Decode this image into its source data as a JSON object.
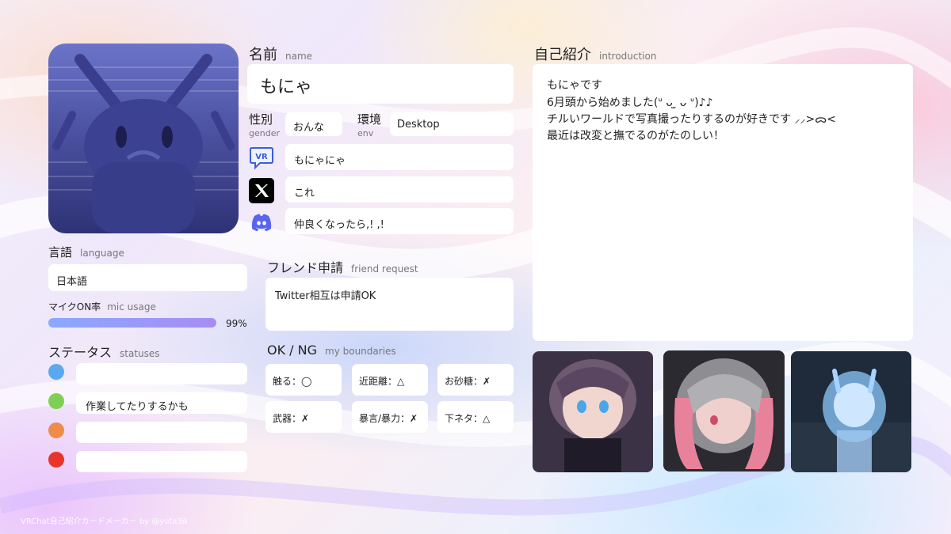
{
  "profile": {
    "name_label": "名前",
    "name_label_en": "name",
    "name_value": "もにゃ",
    "gender_label": "性別",
    "gender_label_en": "gender",
    "gender_value": "おんな",
    "env_label": "環境",
    "env_label_en": "env",
    "env_value": "Desktop",
    "vrchat_id": "もにゃにゃ",
    "x_id": "これ",
    "discord_id": "仲良くなったら,! ,!"
  },
  "language": {
    "label": "言語",
    "label_en": "language",
    "value": "日本語"
  },
  "mic": {
    "label": "マイクON率",
    "label_en": "mic usage",
    "percent_text": "99%",
    "level": 0.99
  },
  "statuses": {
    "label": "ステータス",
    "label_en": "statuses",
    "items": [
      {
        "color": "#5ba8ef",
        "text": ""
      },
      {
        "color": "#7fcf56",
        "text": "作業してたりするかも"
      },
      {
        "color": "#ef8c4a",
        "text": ""
      },
      {
        "color": "#e8352c",
        "text": ""
      }
    ]
  },
  "friend_request": {
    "label": "フレンド申請",
    "label_en": "friend request",
    "value": "Twitter相互は申請OK"
  },
  "boundaries": {
    "label": "OK / NG",
    "label_en": "my boundaries",
    "items": [
      "触る：◯",
      "近距離：△",
      "お砂糖：✗",
      "武器：✗",
      "暴言/暴力：✗",
      "下ネタ：△"
    ]
  },
  "introduction": {
    "label": "自己紹介",
    "label_en": "introduction",
    "lines": [
      "もにゃです",
      "6月頭から始めました(ᐡ ᴗ ̫ ᴗ ᐡ)♪♪",
      "チルいワールドで写真撮ったりするのが好きです ⸝⸝>ᯅ<",
      "最近は改変と撫でるのがたのしい！"
    ]
  },
  "footer": "VRChat自己紹介カードメーカー by @yota3d",
  "icons": {
    "vrchat": "vrchat-icon",
    "x": "x-logo-icon",
    "discord": "discord-icon"
  },
  "colors": {
    "mic_bar_start": "#8aa9ff",
    "mic_bar_end": "#a88cf2",
    "vrchat_icon": "#3a5fd9",
    "discord_icon": "#5865f2"
  }
}
